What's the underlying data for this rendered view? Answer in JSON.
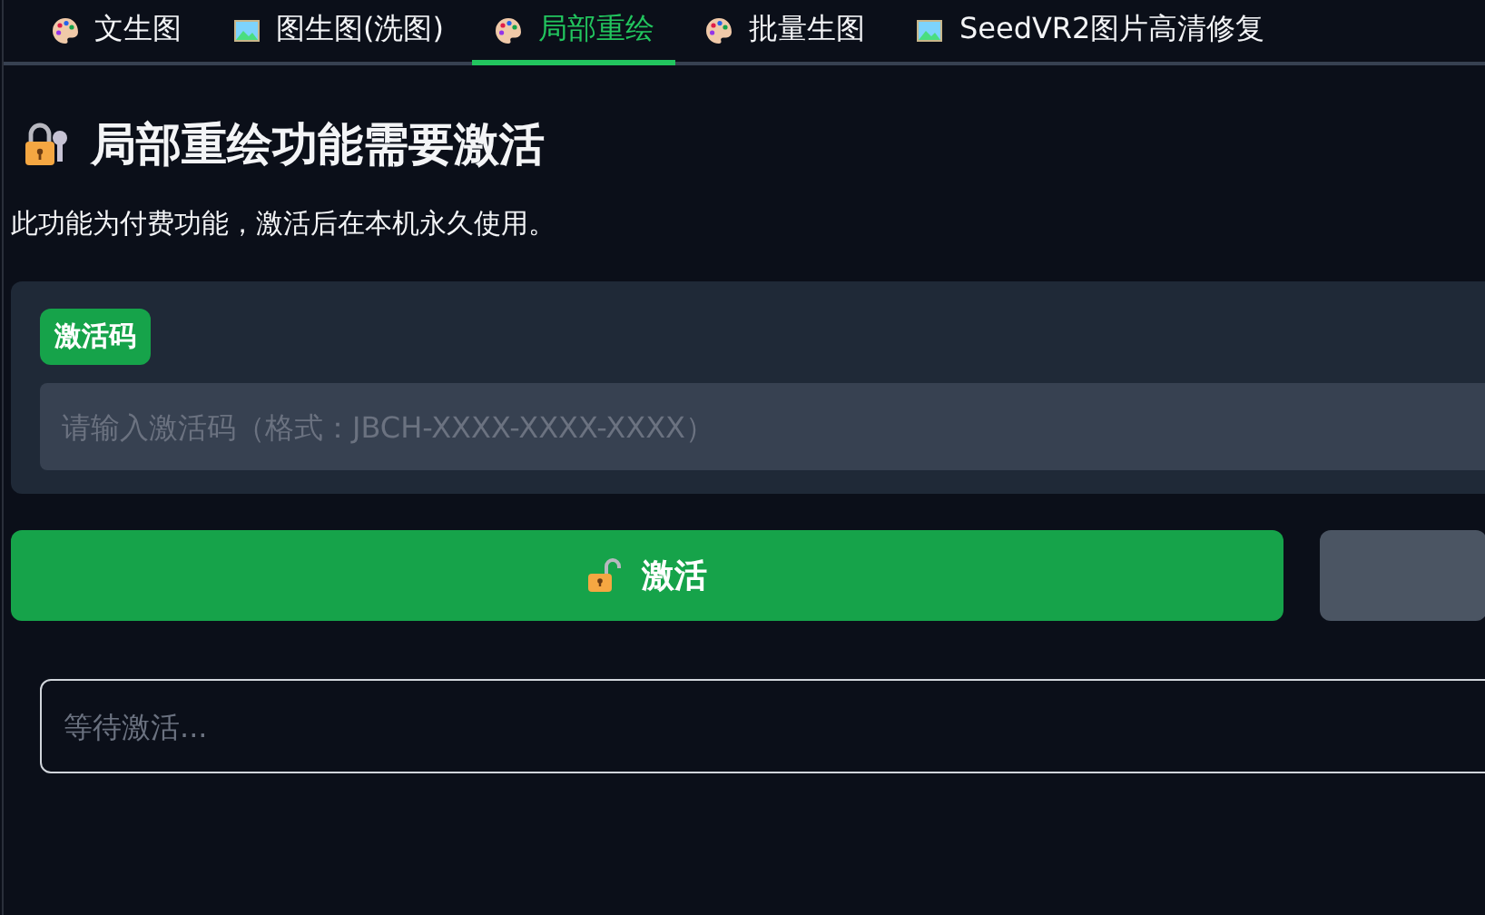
{
  "tabs": [
    {
      "label": "文生图",
      "kind": "palette",
      "selected": false
    },
    {
      "label": "图生图(洗图)",
      "kind": "picture",
      "selected": false
    },
    {
      "label": "局部重绘",
      "kind": "palette",
      "selected": true
    },
    {
      "label": "批量生图",
      "kind": "palette",
      "selected": false
    },
    {
      "label": "SeedVR2图片高清修复",
      "kind": "picture",
      "selected": false
    }
  ],
  "heading": "局部重绘功能需要激活",
  "description": "此功能为付费功能，激活后在本机永久使用。",
  "activation_code": {
    "label": "激活码",
    "placeholder": "请输入激活码（格式：JBCH-XXXX-XXXX-XXXX）"
  },
  "activate_button": {
    "label": "激活"
  },
  "status": {
    "placeholder": "等待激活..."
  }
}
